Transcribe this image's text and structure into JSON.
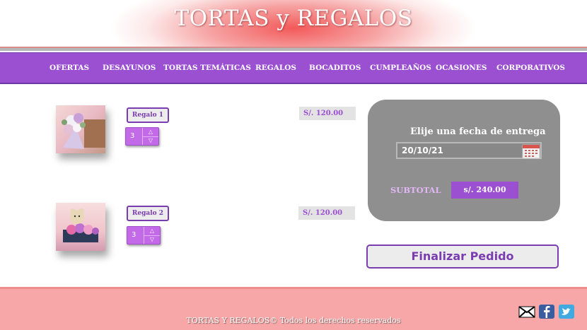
{
  "header": {
    "title": "TORTAS y REGALOS"
  },
  "nav": {
    "items": [
      {
        "label": "OFERTAS"
      },
      {
        "label": "DESAYUNOS"
      },
      {
        "label": "TORTAS TEMÁTICAS"
      },
      {
        "label": "REGALOS"
      },
      {
        "label": "BOCADITOS"
      },
      {
        "label": "CUMPLEAÑOS"
      },
      {
        "label": "OCASIONES"
      },
      {
        "label": "CORPORATIVOS"
      }
    ]
  },
  "cart": {
    "items": [
      {
        "name": "Regalo 1",
        "quantity": "3",
        "price": "S/. 120.00"
      },
      {
        "name": "Regalo 2",
        "quantity": "3",
        "price": "S/. 120.00"
      }
    ]
  },
  "summary": {
    "date_label": "Elije una fecha de entrega",
    "date_value": "20/10/21",
    "subtotal_label": "SUBTOTAL",
    "subtotal_value": "s/. 240.00"
  },
  "actions": {
    "finalize_label": "Finalizar Pedido"
  },
  "footer": {
    "copyright": "TORTAS Y REGALOS© Todos los derechos reservados"
  },
  "colors": {
    "accent": "#9b4fd1",
    "header": "#f35a5a",
    "footer": "#f7a7a7",
    "panel": "#8f8f8f"
  }
}
